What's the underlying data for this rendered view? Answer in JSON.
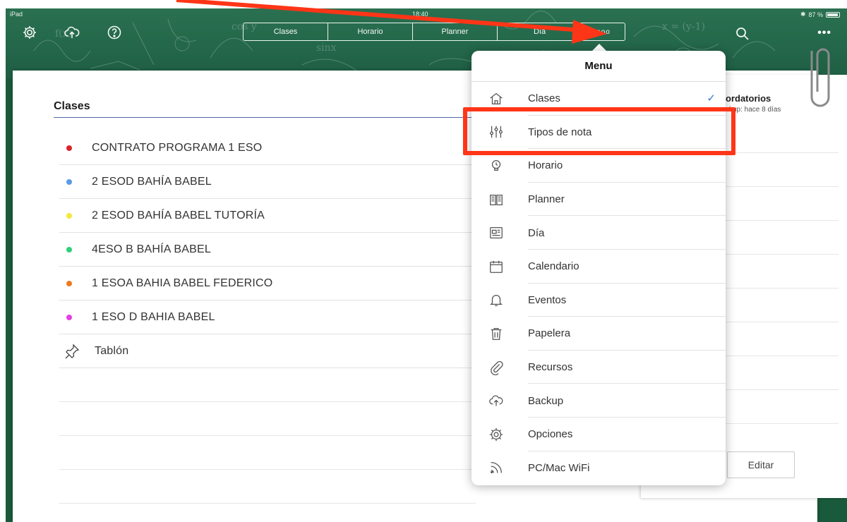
{
  "status_bar": {
    "device": "iPad",
    "time": "18:40",
    "battery": "87 %"
  },
  "toolbar": {
    "left_icons": [
      "gear-icon",
      "cloud-upload-icon",
      "help-icon"
    ],
    "segments": [
      {
        "label": "Clases"
      },
      {
        "label": "Horario"
      },
      {
        "label": "Planner"
      },
      {
        "label": "Día"
      },
      {
        "label": "ooo"
      }
    ],
    "search_icon": "search-icon",
    "more_label": "•••"
  },
  "notebook": {
    "title": "Clases",
    "classes": [
      {
        "label": "CONTRATO PROGRAMA 1 ESO",
        "color": "#d8242a"
      },
      {
        "label": "2 ESOD BAHÍA BABEL",
        "color": "#5a9be8"
      },
      {
        "label": "2 ESOD BAHÍA BABEL TUTORÍA",
        "color": "#f2e93a"
      },
      {
        "label": "4ESO B BAHÍA BABEL",
        "color": "#2fd07a"
      },
      {
        "label": "1 ESOA  BAHIA BABEL FEDERICO",
        "color": "#ee7a22"
      },
      {
        "label": "1 ESO D BAHIA BABEL",
        "color": "#e440e4"
      }
    ],
    "board_item": {
      "label": "Tablón",
      "icon": "pushpin-icon"
    }
  },
  "side_panel": {
    "title": "ordatorios",
    "subtitle": "ckup: hace 8 días",
    "edit_label": "Editar"
  },
  "menu": {
    "title": "Menu",
    "items": [
      {
        "label": "Clases",
        "icon": "home-icon",
        "selected": true
      },
      {
        "label": "Tipos de nota",
        "icon": "sliders-icon",
        "selected": false
      },
      {
        "label": "Horario",
        "icon": "lightbulb-icon",
        "selected": false
      },
      {
        "label": "Planner",
        "icon": "book-icon",
        "selected": false
      },
      {
        "label": "Día",
        "icon": "day-icon",
        "selected": false
      },
      {
        "label": "Calendario",
        "icon": "calendar-icon",
        "selected": false
      },
      {
        "label": "Eventos",
        "icon": "bell-icon",
        "selected": false
      },
      {
        "label": "Papelera",
        "icon": "trash-icon",
        "selected": false
      },
      {
        "label": "Recursos",
        "icon": "paperclip-icon",
        "selected": false
      },
      {
        "label": "Backup",
        "icon": "cloud-upload-icon",
        "selected": false
      },
      {
        "label": "Opciones",
        "icon": "gear-icon",
        "selected": false
      },
      {
        "label": "PC/Mac WiFi",
        "icon": "wifi-icon",
        "selected": false
      }
    ],
    "check_mark": "✓"
  },
  "annotation": {
    "highlight_color": "#ff3517"
  }
}
